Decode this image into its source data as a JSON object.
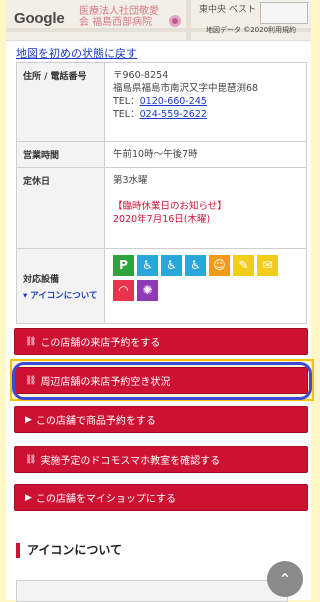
{
  "map": {
    "google_logo": "Google",
    "hospital_label_1": "医療法人社団敬愛",
    "hospital_label_2": "会 福島西部病院",
    "east_label": "東中央 ベスト",
    "map_data": "地図データ ©2020",
    "terms": "利用規約"
  },
  "reset_link": "地図を初めの状態に戻す",
  "info": {
    "address_header": "住所 / 電話番号",
    "postal": "〒960-8254",
    "address": "福島県福島市南沢又字中毘琶渕68",
    "tel1_prefix": "TEL：",
    "tel1": "0120-660-245",
    "tel2_prefix": "TEL：",
    "tel2": "024-559-2622",
    "hours_header": "営業時間",
    "hours": "午前10時～午後7時",
    "closed_header": "定休日",
    "closed": "第3水曜",
    "notice_title": "【臨時休業日のお知らせ】",
    "notice_date": "2020年7月16日(木曜)",
    "facilities_header": "対応設備",
    "icon_about": "▾ アイコンについて",
    "facility_icons": [
      {
        "name": "parking-icon",
        "glyph": "P",
        "color": "#2fa33d"
      },
      {
        "name": "wheelchair-icon",
        "glyph": "♿",
        "color": "#2aa7d9"
      },
      {
        "name": "wheelchair-parking-icon",
        "glyph": "♿",
        "color": "#2aa7d9"
      },
      {
        "name": "accessible-entrance-icon",
        "glyph": "♿",
        "color": "#2aa7d9"
      },
      {
        "name": "smile-icon",
        "glyph": "☺",
        "color": "#f49a1b"
      },
      {
        "name": "pen-icon",
        "glyph": "✎",
        "color": "#f2cd1a"
      },
      {
        "name": "envelope-icon",
        "glyph": "✉",
        "color": "#f2cd1a"
      },
      {
        "name": "wifi-icon",
        "glyph": "◠",
        "color": "#e8344b"
      },
      {
        "name": "charging-icon",
        "glyph": "✺",
        "color": "#8e3ab4"
      }
    ]
  },
  "buttons": {
    "visit_reservation": "この店舗の来店予約をする",
    "nearby_availability": "周辺店舗の来店予約空き状況",
    "product_reservation": "この店舗で商品予約をする",
    "smartphone_class": "実施予定のドコモスマホ教室を確認する",
    "my_shop": "この店舗をマイショップにする"
  },
  "section_title": "アイコンについて"
}
